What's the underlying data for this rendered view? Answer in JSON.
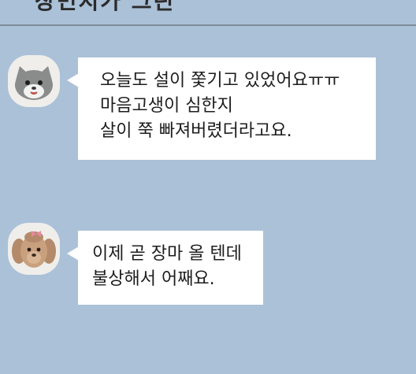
{
  "header": {
    "title": "장민지가 그린"
  },
  "messages": [
    {
      "avatar_icon": "cat-avatar-icon",
      "lines": [
        "오늘도 설이 쫓기고 있었어요ㅠㅠ",
        "마음고생이 심한지",
        "살이 쭉 빠져버렸더라고요."
      ]
    },
    {
      "avatar_icon": "poodle-avatar-icon",
      "lines": [
        "이제 곧 장마 올 텐데",
        "불상해서 어째요."
      ]
    }
  ],
  "colors": {
    "background": "#abc1d8",
    "bubble": "#ffffff",
    "text": "#1d1d1d"
  }
}
